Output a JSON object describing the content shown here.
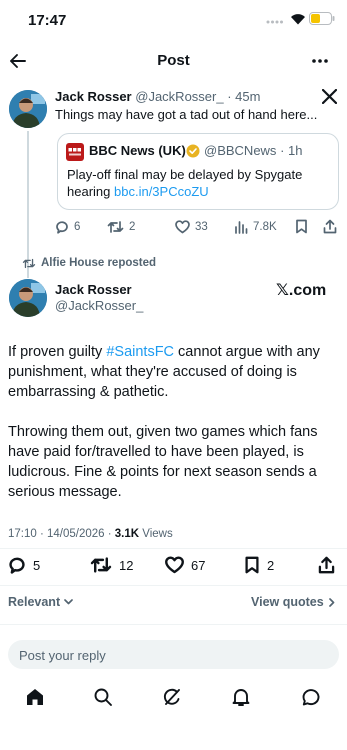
{
  "status_bar": {
    "time": "17:47"
  },
  "header": {
    "title": "Post"
  },
  "quoted_post": {
    "author_name": "Jack Rosser",
    "author_handle": "@JackRosser_",
    "time_ago": "· 45m",
    "text": "Things may have got a tad out of hand here...",
    "embed": {
      "source_name": "BBC News (UK)",
      "source_handle": "@BBCNews",
      "source_time": "· 1h",
      "text": "Play-off final may be delayed by Spygate hearing",
      "link": "bbc.in/3PCcoZU"
    },
    "actions": {
      "replies": "6",
      "reposts": "2",
      "likes": "33",
      "views": "7.8K"
    }
  },
  "repost_label": "Alfie House reposted",
  "main_post": {
    "author_name": "Jack Rosser",
    "author_handle": "@JackRosser_",
    "brand": "𝕏.com",
    "text_part1": "If proven guilty ",
    "hashtag": "#SaintsFC",
    "text_part2": " cannot argue with any punishment, what they're accused of doing is embarrassing & pathetic.",
    "text_para2": "Throwing them out, given two games which fans have paid for/travelled to have been played, is ludicrous. Fine & points for next season sends a serious message.",
    "timestamp": "17:10 · 14/05/2026 · ",
    "views_count": "3.1K",
    "views_label": " Views",
    "actions": {
      "replies": "5",
      "reposts": "12",
      "likes": "67",
      "bookmarks": "2"
    }
  },
  "sort": {
    "label": "Relevant",
    "view_quotes": "View quotes"
  },
  "reply": {
    "placeholder": "Post your reply"
  },
  "colors": {
    "accent": "#1d9bf0",
    "muted": "#536471",
    "verified": "#e8b322",
    "bbc_red": "#bb1919"
  }
}
